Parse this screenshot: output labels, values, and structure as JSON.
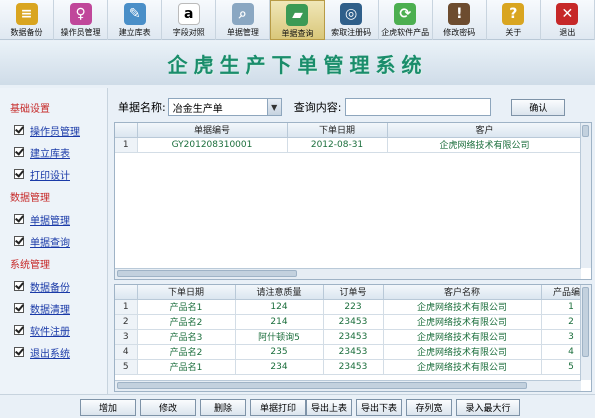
{
  "toolbar": [
    {
      "label": "数据备份",
      "icon": "database-backup-icon",
      "color": "#d9a520",
      "glyph": "≡"
    },
    {
      "label": "操作员管理",
      "icon": "operator-icon",
      "color": "#c0479a",
      "glyph": "♀"
    },
    {
      "label": "建立库表",
      "icon": "create-table-icon",
      "color": "#4a8fc8",
      "glyph": "✎"
    },
    {
      "label": "字段对照",
      "icon": "amazon-icon",
      "color": "#ffffff",
      "glyph": "a"
    },
    {
      "label": "单据管理",
      "icon": "magnifier-icon",
      "color": "#8aa7c2",
      "glyph": "⌕"
    },
    {
      "label": "单据查询",
      "icon": "query-doc-icon",
      "color": "#3b9a55",
      "glyph": "▰"
    },
    {
      "label": "索取注册码",
      "icon": "register-code-icon",
      "color": "#2f5f8a",
      "glyph": "◎"
    },
    {
      "label": "企虎软件产品",
      "icon": "refresh-icon",
      "color": "#4caf50",
      "glyph": "⟳"
    },
    {
      "label": "修改密码",
      "icon": "password-icon",
      "color": "#6d4c2f",
      "glyph": "!"
    },
    {
      "label": "关于",
      "icon": "about-icon",
      "color": "#d9a520",
      "glyph": "?"
    },
    {
      "label": "退出",
      "icon": "exit-icon",
      "color": "#c62828",
      "glyph": "✕"
    }
  ],
  "active_tool": 5,
  "banner": {
    "title": "企虎生产下单管理系统"
  },
  "sidebar": {
    "groups": [
      {
        "title": "基础设置",
        "items": [
          "操作员管理",
          "建立库表",
          "打印设计"
        ]
      },
      {
        "title": "数据管理",
        "items": [
          "单据管理",
          "单据查询"
        ]
      },
      {
        "title": "系统管理",
        "items": [
          "数据备份",
          "数据清理",
          "软件注册",
          "退出系统"
        ]
      }
    ]
  },
  "search": {
    "doc_label": "单据名称:",
    "doc_value": "冶金生产单",
    "query_label": "查询内容:",
    "query_value": "",
    "ok_label": "确认"
  },
  "top_grid": {
    "columns": [
      "单据编号",
      "下单日期",
      "客户"
    ],
    "rows": [
      {
        "n": "1",
        "cells": [
          "GY201208310001",
          "2012-08-31",
          "企虎网络技术有限公司"
        ]
      }
    ]
  },
  "bottom_grid": {
    "columns": [
      "下单日期",
      "请注意质量",
      "订单号",
      "客户名称",
      "产品编号"
    ],
    "rows": [
      {
        "n": "1",
        "cells": [
          "产品名1",
          "124",
          "223",
          "企虎网络技术有限公司",
          "1"
        ]
      },
      {
        "n": "2",
        "cells": [
          "产品名2",
          "214",
          "23453",
          "企虎网络技术有限公司",
          "2"
        ]
      },
      {
        "n": "3",
        "cells": [
          "产品名3",
          "阿什顿询5",
          "23453",
          "企虎网络技术有限公司",
          "3"
        ]
      },
      {
        "n": "4",
        "cells": [
          "产品名2",
          "235",
          "23453",
          "企虎网络技术有限公司",
          "4"
        ]
      },
      {
        "n": "5",
        "cells": [
          "产品名1",
          "234",
          "23453",
          "企虎网络技术有限公司",
          "5"
        ]
      }
    ]
  },
  "buttons": [
    "增加",
    "修改",
    "删除",
    "单据打印",
    "导出上表",
    "导出下表",
    "存列宽",
    "录入最大行"
  ]
}
